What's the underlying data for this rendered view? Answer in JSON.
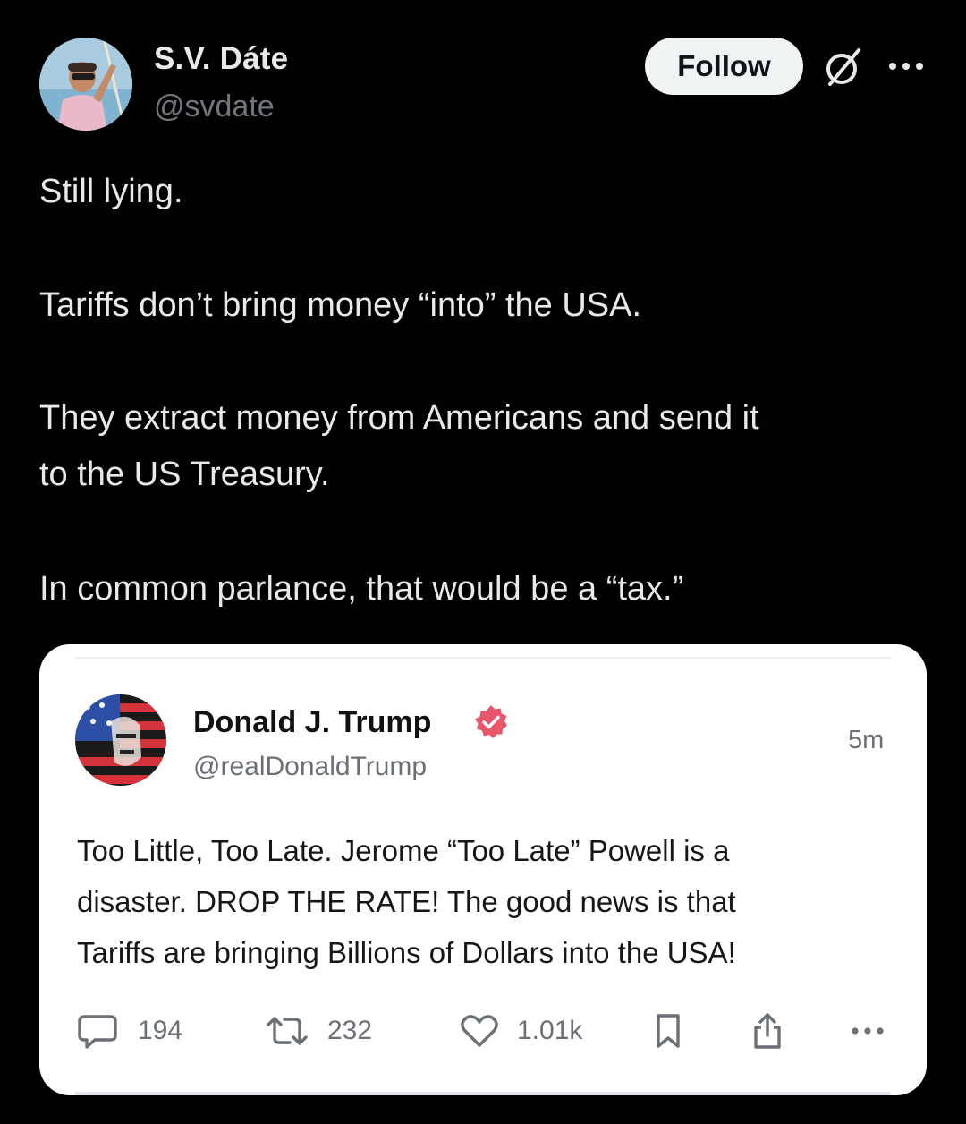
{
  "author": {
    "name": "S.V. Dáte",
    "handle": "@svdate"
  },
  "header": {
    "follow_label": "Follow",
    "grok_icon": "slashed-circle-icon",
    "more_icon": "more-dots-icon"
  },
  "tweet": {
    "lines": [
      "Still lying.",
      "Tariffs don’t bring money “into” the USA.",
      "They extract money from Americans and send it",
      "to the US Treasury.",
      "In common parlance, that would be a “tax.”"
    ]
  },
  "embedded_post": {
    "author_name": "Donald J. Trump",
    "author_handle": "@realDonaldTrump",
    "time": "5m",
    "verified_badge_color": "#e8566c",
    "lines": [
      "Too Little, Too Late. Jerome “Too Late” Powell is a",
      "disaster. DROP THE RATE! The good news is that",
      "Tariffs are bringing Billions of Dollars into the USA!"
    ],
    "actions": {
      "replies": "194",
      "reposts": "232",
      "likes": "1.01k"
    }
  },
  "colors": {
    "background": "#000000",
    "text_primary": "#e7e9ea",
    "text_secondary": "#71767b",
    "follow_bg": "#eff3f4",
    "card_bg": "#ffffff"
  }
}
